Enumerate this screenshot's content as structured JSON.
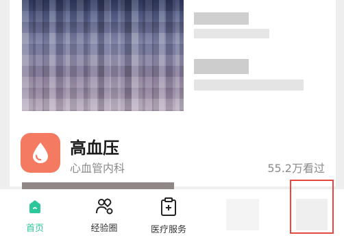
{
  "card": {
    "title": "高血压",
    "category": "心血管内科",
    "views": "55.2万看过",
    "icon": "water-drop-icon",
    "accent_color": "#f57a62"
  },
  "bottom_nav": {
    "active_color": "#2cc79a",
    "items": [
      {
        "label": "首页",
        "icon": "home-icon",
        "active": true
      },
      {
        "label": "经验圈",
        "icon": "community-icon",
        "active": false
      },
      {
        "label": "医疗服务",
        "icon": "medical-service-icon",
        "active": false
      }
    ]
  },
  "highlight_color": "#e2483b"
}
